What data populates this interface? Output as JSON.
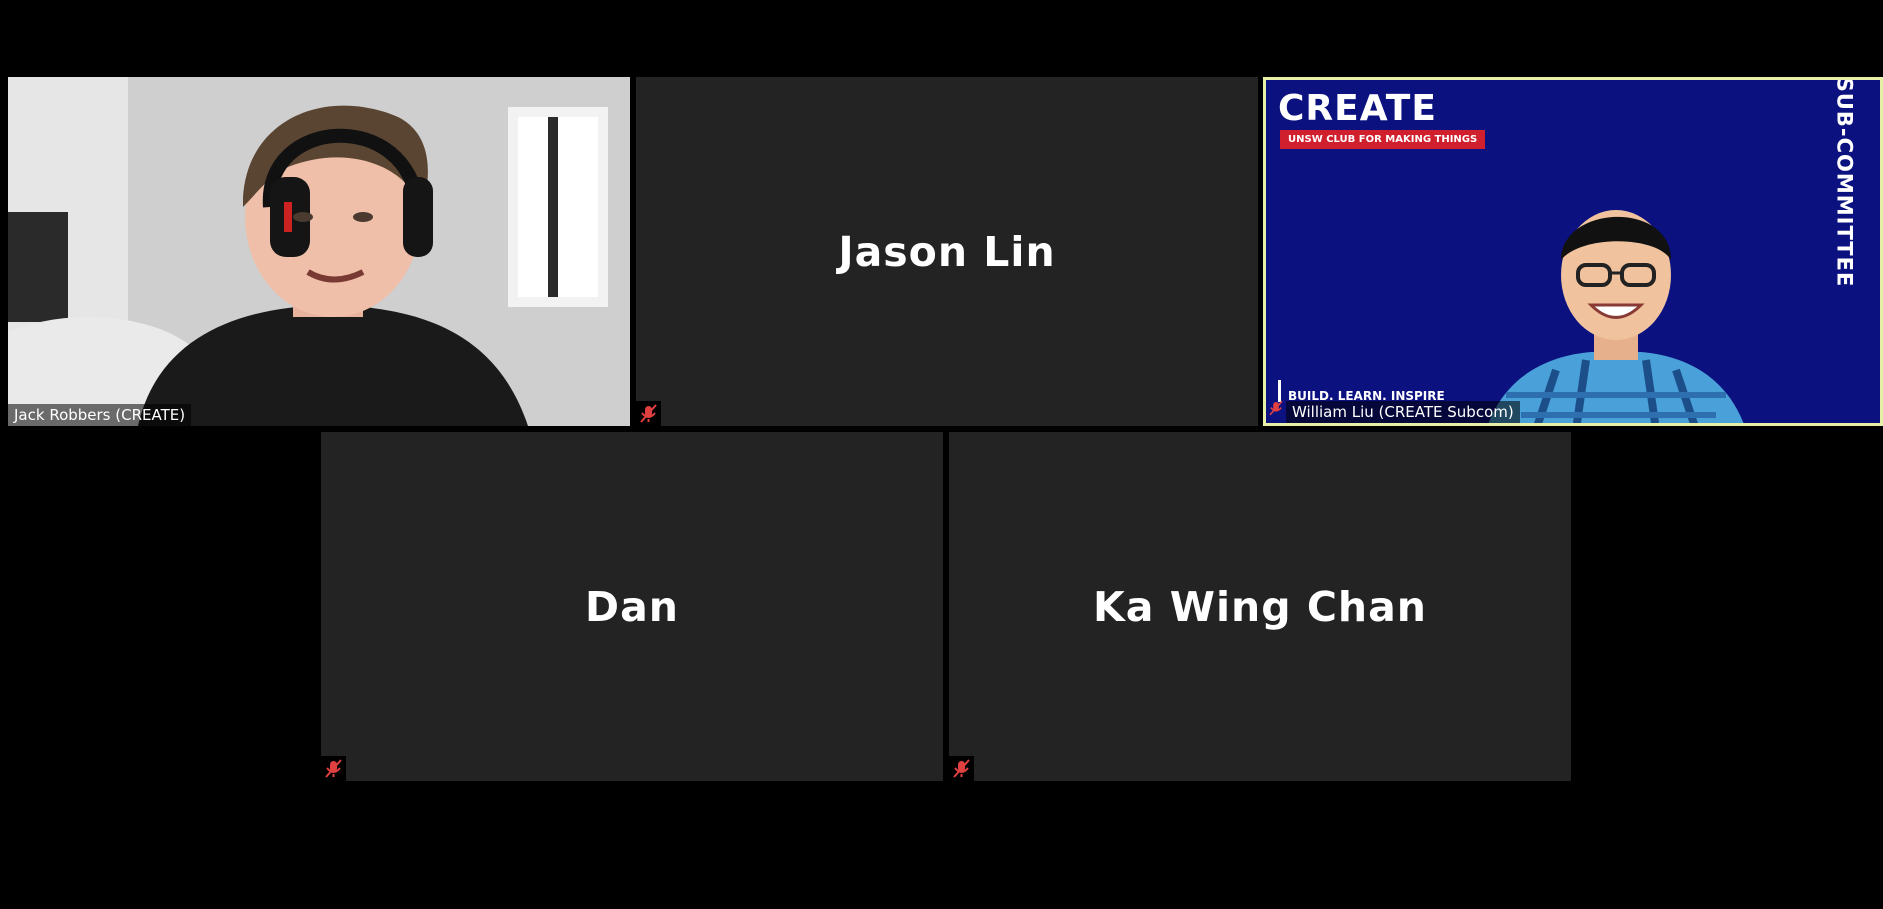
{
  "participants": [
    {
      "name": "Jack Robbers (CREATE)",
      "video": true,
      "muted": false
    },
    {
      "name": "Jason Lin",
      "video": false,
      "muted": true
    },
    {
      "name": "William Liu (CREATE Subcom)",
      "video": true,
      "muted": true,
      "active_speaker": true
    },
    {
      "name": "Dan",
      "video": false,
      "muted": true
    },
    {
      "name": "Ka Wing Chan",
      "video": false,
      "muted": true
    }
  ],
  "background": {
    "logo": "CREATE",
    "tagline": "UNSW CLUB FOR MAKING THINGS",
    "side_text": "SUB-COMMITTEE",
    "motto": "BUILD. LEARN. INSPIRE"
  },
  "colors": {
    "tile_bg": "#232323",
    "active_border": "#e7f0a6",
    "mute_icon": "#e04040",
    "brand_blue": "#0c1180",
    "brand_red": "#d0202e"
  },
  "icons": [
    "muted-mic-icon"
  ]
}
